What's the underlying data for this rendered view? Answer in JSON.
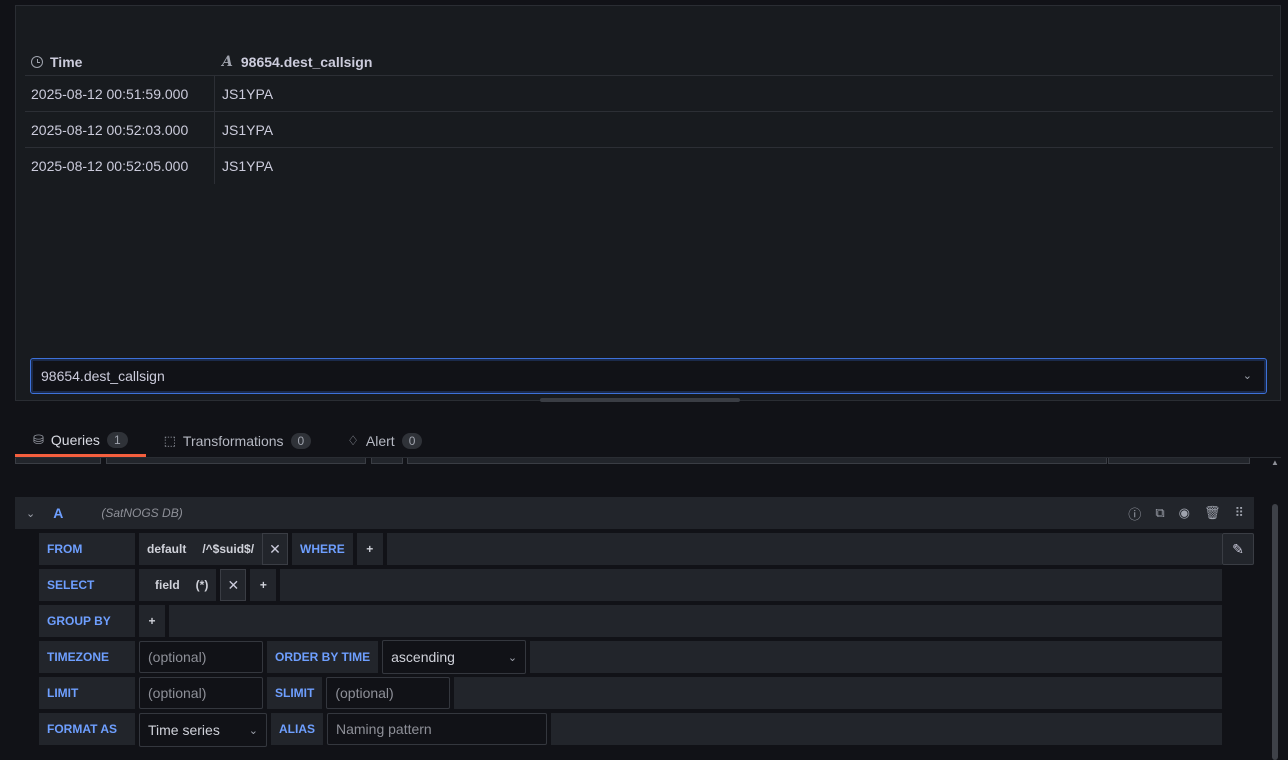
{
  "table": {
    "columns": [
      {
        "label": "Time",
        "icon": "clock-icon"
      },
      {
        "label": "98654.dest_callsign",
        "icon": "text-field-icon"
      }
    ],
    "rows": [
      {
        "time": "2025-08-12 00:51:59.000",
        "value": "JS1YPA"
      },
      {
        "time": "2025-08-12 00:52:03.000",
        "value": "JS1YPA"
      },
      {
        "time": "2025-08-12 00:52:05.000",
        "value": "JS1YPA"
      }
    ]
  },
  "field_select": {
    "value": "98654.dest_callsign"
  },
  "tabs": [
    {
      "label": "Queries",
      "count": "1",
      "active": true,
      "icon": "database-icon"
    },
    {
      "label": "Transformations",
      "count": "0",
      "active": false,
      "icon": "transform-icon"
    },
    {
      "label": "Alert",
      "count": "0",
      "active": false,
      "icon": "bell-icon"
    }
  ],
  "query": {
    "name": "A",
    "datasource": "(SatNOGS DB)",
    "from": {
      "keyword": "FROM",
      "policy": "default",
      "measurement": "/^$suid$/",
      "where": "WHERE",
      "plus": "+"
    },
    "select": {
      "keyword": "SELECT",
      "field": "field",
      "agg": "(*)",
      "plus": "+"
    },
    "group_by": {
      "keyword": "GROUP BY",
      "plus": "+"
    },
    "timezone": {
      "keyword": "TIMEZONE",
      "placeholder": "(optional)",
      "order_label": "ORDER BY TIME",
      "order_value": "ascending"
    },
    "limit": {
      "keyword": "LIMIT",
      "placeholder": "(optional)",
      "slimit_label": "SLIMIT",
      "slimit_placeholder": "(optional)"
    },
    "format": {
      "keyword": "FORMAT AS",
      "value": "Time series",
      "alias_label": "ALIAS",
      "alias_placeholder": "Naming pattern"
    }
  },
  "colors": {
    "accent": "#6e9fff",
    "active_tab": "#f55f3e",
    "focus": "#3d71d9"
  }
}
